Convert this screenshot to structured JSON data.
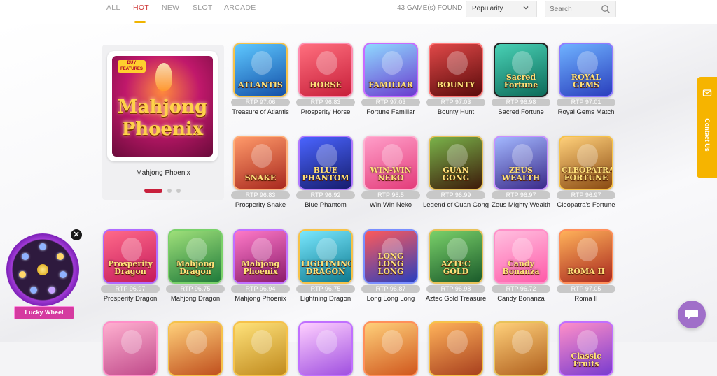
{
  "filters": {
    "tabs": [
      {
        "label": "ALL"
      },
      {
        "label": "HOT",
        "active": true
      },
      {
        "label": "NEW"
      },
      {
        "label": "SLOT"
      },
      {
        "label": "ARCADE"
      }
    ],
    "count_text": "43 GAME(s) FOUND",
    "sort_value": "Popularity",
    "search_placeholder": "Search"
  },
  "featured": {
    "badge_text": "BUY FEATURES",
    "art_line1": "Mahjong",
    "art_line2": "Phoenix",
    "name": "Mahjong Phoenix",
    "slide_count": 3,
    "active_slide": 1
  },
  "games_row1": [
    {
      "title": "ATLANTIS",
      "rtp": "RTP 97.06",
      "name": "Treasure of Atlantis",
      "colors": [
        "#5ec8ff",
        "#1450a8"
      ],
      "border": "#f6c24a"
    },
    {
      "title": "HORSE",
      "rtp": "RTP 96.83",
      "name": "Prosperity Horse",
      "colors": [
        "#ff6f7e",
        "#c71f3a"
      ],
      "border": "#ff8fb1"
    },
    {
      "title": "FAMILIAR",
      "rtp": "RTP 97.03",
      "name": "Fortune Familiar",
      "colors": [
        "#8fd9ff",
        "#6a3ccf"
      ],
      "border": "#c86bff"
    },
    {
      "title": "BOUNTY",
      "rtp": "RTP 97.03",
      "name": "Bounty Hunt",
      "colors": [
        "#e04848",
        "#5a0b0b"
      ],
      "border": "#ff7a7a"
    },
    {
      "title": "Sacred Fortune",
      "rtp": "RTP 96.98",
      "name": "Sacred Fortune",
      "colors": [
        "#49d1b5",
        "#0d6b5a"
      ],
      "border": "#222222"
    },
    {
      "title": "ROYAL GEMS",
      "rtp": "RTP 97.01",
      "name": "Royal Gems Match",
      "colors": [
        "#6fb2ff",
        "#2a3fbd"
      ],
      "border": "#8f7bff"
    }
  ],
  "games_row2": [
    {
      "title": "SNAKE",
      "rtp": "RTP 96.83",
      "name": "Prosperity Snake",
      "colors": [
        "#ff9a6a",
        "#a8281e"
      ],
      "border": "#ffb07a"
    },
    {
      "title": "BLUE PHANTOM",
      "rtp": "RTP 96.92",
      "name": "Blue Phantom",
      "colors": [
        "#4a64ff",
        "#161d6e"
      ],
      "border": "#b07aff"
    },
    {
      "title": "WIN-WIN NEKO",
      "rtp": "RTP 96.5",
      "name": "Win Win Neko",
      "colors": [
        "#ff9ec9",
        "#e33c7a"
      ],
      "border": "#ffb0d0"
    },
    {
      "title": "GUAN GONG",
      "rtp": "RTP 96.99",
      "name": "Legend of Guan Gong",
      "colors": [
        "#7ab34a",
        "#3d1a0a"
      ],
      "border": "#e8c25a"
    },
    {
      "title": "ZEUS WEALTH",
      "rtp": "RTP 96.97",
      "name": "Zeus Mighty Wealth",
      "colors": [
        "#a3b8ff",
        "#3a2a8a"
      ],
      "border": "#c890ff"
    },
    {
      "title": "CLEOPATRA'S FORTUNE",
      "rtp": "RTP 96.97",
      "name": "Cleopatra's Fortune",
      "colors": [
        "#ffd07a",
        "#8a4a12"
      ],
      "border": "#f6c24a"
    }
  ],
  "games_row3": [
    {
      "title": "Prosperity Dragon",
      "rtp": "RTP 96.97",
      "name": "Prosperity Dragon",
      "colors": [
        "#ff6a8a",
        "#c4195a"
      ],
      "border": "#b06bff"
    },
    {
      "title": "Mahjong Dragon",
      "rtp": "RTP 96.75",
      "name": "Mahjong Dragon",
      "colors": [
        "#9fe07a",
        "#1f7a3a"
      ],
      "border": "#7ad16a"
    },
    {
      "title": "Mahjong Phoenix",
      "rtp": "RTP 96.94",
      "name": "Mahjong Phoenix",
      "colors": [
        "#ff7ac8",
        "#8a1a6a"
      ],
      "border": "#c070ff"
    },
    {
      "title": "LIGHTNING DRAGON",
      "rtp": "RTP 96.75",
      "name": "Lightning Dragon",
      "colors": [
        "#7ae8ff",
        "#0e7a8f"
      ],
      "border": "#f6c24a"
    },
    {
      "title": "LONG LONG LONG",
      "rtp": "RTP 96.87",
      "name": "Long Long Long",
      "colors": [
        "#ff5a5a",
        "#2a3fbd"
      ],
      "border": "#7a8fff"
    },
    {
      "title": "AZTEC GOLD",
      "rtp": "RTP 96.98",
      "name": "Aztec Gold Treasure",
      "colors": [
        "#7ad16a",
        "#1a5a2a"
      ],
      "border": "#e8c25a"
    },
    {
      "title": "Candy Bonanza",
      "rtp": "RTP 96.72",
      "name": "Candy Bonanza",
      "colors": [
        "#ffc0e0",
        "#ff5aa8"
      ],
      "border": "#ff8fc8"
    },
    {
      "title": "ROMA II",
      "rtp": "RTP 97.05",
      "name": "Roma II",
      "colors": [
        "#ffb25a",
        "#a8281e"
      ],
      "border": "#ff8f5a"
    }
  ],
  "games_row4": [
    {
      "title": "",
      "colors": [
        "#ffb0d0",
        "#c04a8a"
      ],
      "border": "#ff8fc8"
    },
    {
      "title": "",
      "colors": [
        "#ffd07a",
        "#c0501e"
      ],
      "border": "#f6c24a"
    },
    {
      "title": "",
      "colors": [
        "#ffe27a",
        "#c08a1e"
      ],
      "border": "#f6c24a"
    },
    {
      "title": "",
      "colors": [
        "#ffd0ff",
        "#a050e0"
      ],
      "border": "#c070ff"
    },
    {
      "title": "",
      "colors": [
        "#ffd07a",
        "#d0581e"
      ],
      "border": "#ff8f5a"
    },
    {
      "title": "",
      "colors": [
        "#ffb25a",
        "#a8401e"
      ],
      "border": "#f6c24a"
    },
    {
      "title": "",
      "colors": [
        "#ffd07a",
        "#b0601e"
      ],
      "border": "#e8c25a"
    },
    {
      "title": "Classic Fruits",
      "colors": [
        "#ff8fc8",
        "#7a3ccf"
      ],
      "border": "#c070ff"
    }
  ],
  "contact": {
    "label": "Contact Us"
  },
  "lucky_wheel": {
    "label": "Lucky Wheel",
    "close": "✕"
  },
  "colors": {
    "accent": "#f0b400",
    "hot_tab": "#d03a3a",
    "contact_bg": "#f6b400",
    "chat_bg": "#a06fc9"
  }
}
